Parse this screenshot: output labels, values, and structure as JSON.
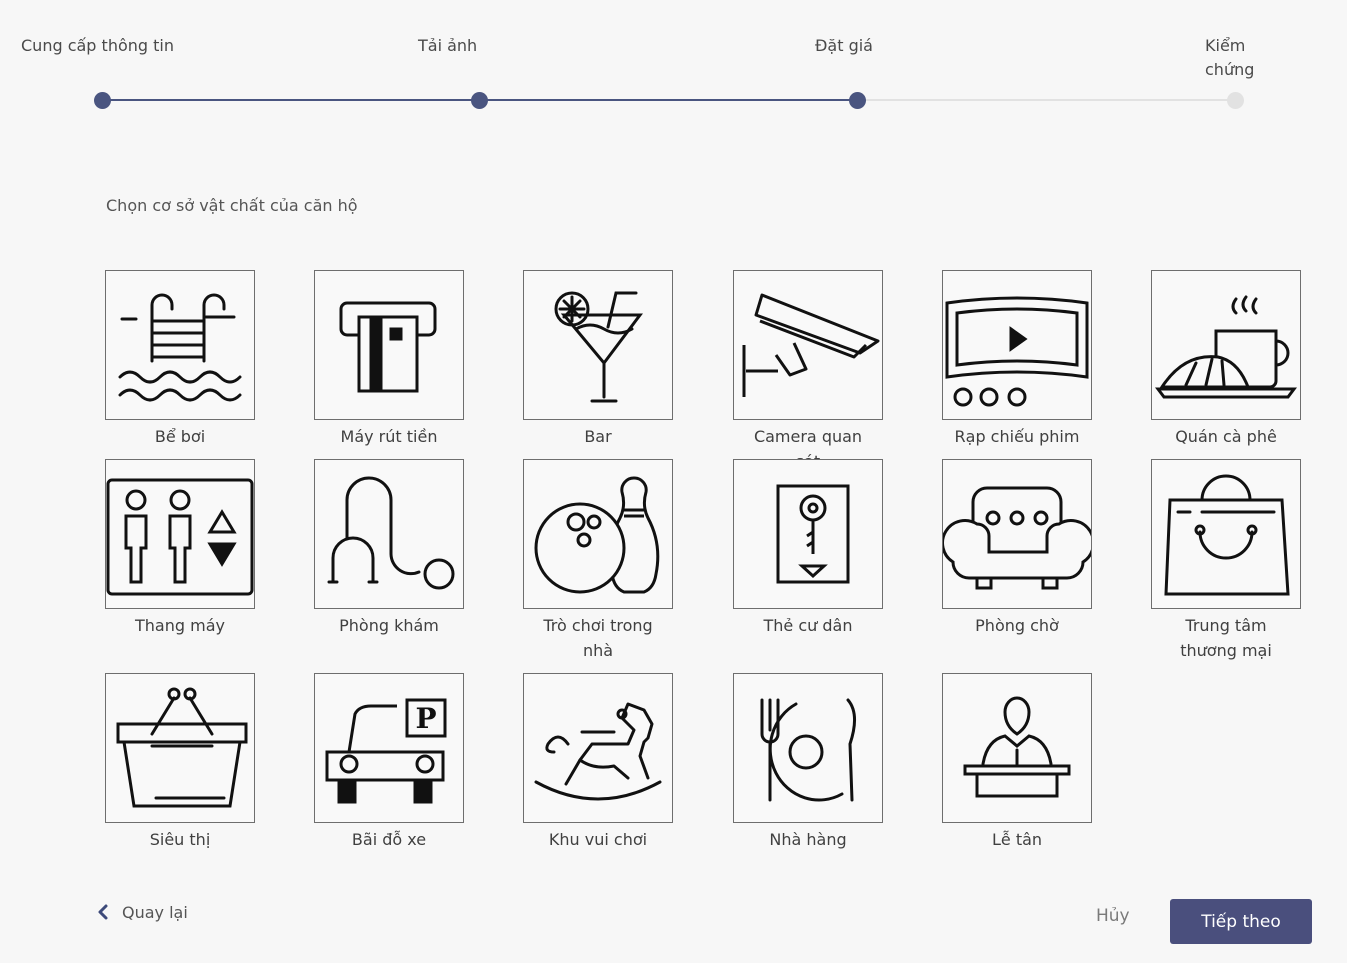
{
  "stepper": {
    "steps": [
      "Cung cấp thông tin",
      "Tải ảnh",
      "Đặt giá",
      "Kiểm chứng"
    ],
    "current_step": 3
  },
  "prompt": "Chọn cơ sở vật chất của căn hộ",
  "amenities": [
    {
      "label": "Bể bơi",
      "icon": "pool-icon"
    },
    {
      "label": "Máy rút tiền",
      "icon": "atm-icon"
    },
    {
      "label": "Bar",
      "icon": "cocktail-icon"
    },
    {
      "label": "Camera quan sát",
      "icon": "security-camera-icon"
    },
    {
      "label": "Rạp chiếu phim",
      "icon": "cinema-icon"
    },
    {
      "label": "Quán cà phê",
      "icon": "coffee-icon"
    },
    {
      "label": "Thang máy",
      "icon": "elevator-icon"
    },
    {
      "label": "Phòng khám",
      "icon": "stethoscope-icon"
    },
    {
      "label": "Trò chơi trong nhà",
      "icon": "bowling-icon"
    },
    {
      "label": "Thẻ cư dân",
      "icon": "key-card-icon"
    },
    {
      "label": "Phòng chờ",
      "icon": "armchair-icon"
    },
    {
      "label": "Trung tâm thương mại",
      "icon": "shopping-bag-icon"
    },
    {
      "label": "Siêu thị",
      "icon": "basket-icon"
    },
    {
      "label": "Bãi đỗ xe",
      "icon": "parking-icon"
    },
    {
      "label": "Khu vui chơi",
      "icon": "rocking-horse-icon"
    },
    {
      "label": "Nhà hàng",
      "icon": "restaurant-icon"
    },
    {
      "label": "Lễ tân",
      "icon": "reception-icon"
    }
  ],
  "footer": {
    "back_label": "Quay lại",
    "cancel_label": "Hủy",
    "next_label": "Tiếp theo"
  },
  "colors": {
    "accent": "#4a4f7d",
    "progress_done": "#4a5580",
    "progress_todo": "#e2e2e2"
  }
}
